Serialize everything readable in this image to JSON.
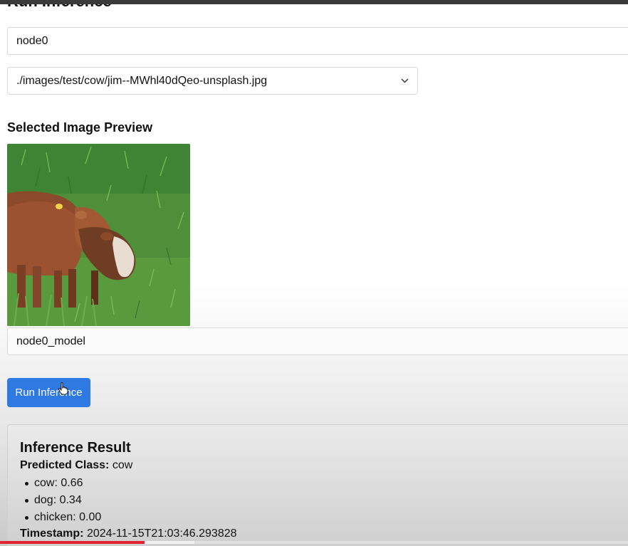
{
  "page": {
    "heading": "Run Inference"
  },
  "node_input": {
    "value": "node0"
  },
  "image_select": {
    "selected": "./images/test/cow/jim--MWhl40dQeo-unsplash.jpg"
  },
  "preview": {
    "heading": "Selected Image Preview"
  },
  "model_input": {
    "value": "node0_model"
  },
  "run_button": {
    "label": "Run Inference"
  },
  "result": {
    "title": "Inference Result",
    "predicted_label": "Predicted Class:",
    "predicted_value": "cow",
    "probabilities": [
      {
        "text": "cow: 0.66"
      },
      {
        "text": "dog: 0.34"
      },
      {
        "text": "chicken: 0.00"
      }
    ],
    "timestamp_label": "Timestamp:",
    "timestamp_value": "2024-11-15T21:03:46.293828"
  },
  "video_progress": {
    "fraction": 0.23,
    "buffered_fraction": 0.31
  },
  "colors": {
    "accent": "#2f79e3",
    "progress": "#e1232f"
  }
}
